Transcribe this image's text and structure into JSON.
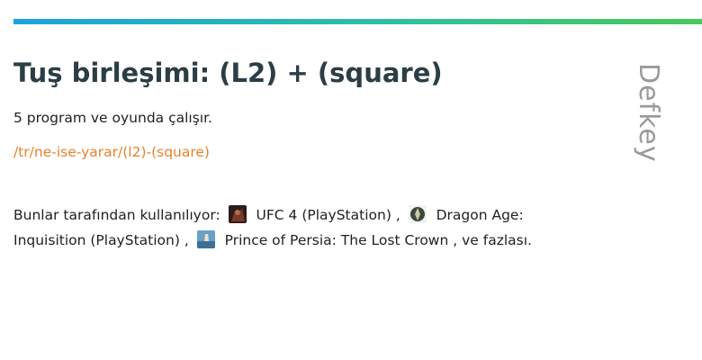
{
  "brand": {
    "name": "Defkey"
  },
  "title": "Tuş birleşimi: (L2) + (square)",
  "subtitle": "5 program ve oyunda çalışır.",
  "url_path": "/tr/ne-ise-yarar/(l2)-(square)",
  "used_by": {
    "prefix": "Bunlar tarafından kullanılıyor:",
    "separator": ",",
    "items": [
      {
        "name": "UFC 4 (PlayStation)",
        "icon": "ufc4-game-icon"
      },
      {
        "name": "Dragon Age: Inquisition (PlayStation)",
        "icon": "dragon-age-game-icon"
      },
      {
        "name": "Prince of Persia: The Lost Crown",
        "icon": "prince-of-persia-game-icon"
      }
    ],
    "suffix": ", ve fazlası."
  },
  "colors": {
    "title": "#2c3e45",
    "link": "#e8822c",
    "brand": "#9a9a9a",
    "bar_start": "#1aa4e0",
    "bar_end": "#48c85a"
  }
}
